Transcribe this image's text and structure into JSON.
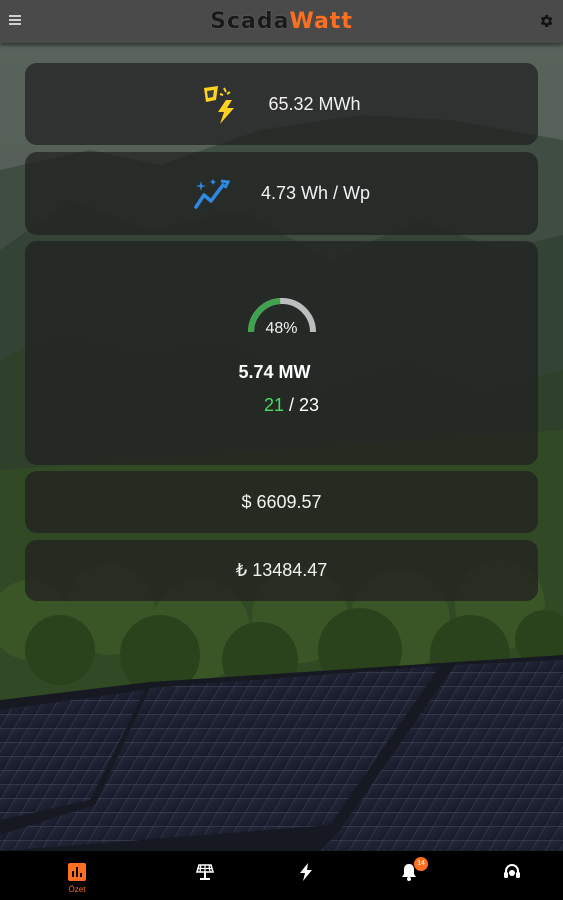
{
  "header": {
    "logo_part1": "Scada",
    "logo_part2": "Watt",
    "menu_icon": "hamburger-icon",
    "settings_icon": "gear-icon"
  },
  "cards": {
    "energy": {
      "icon": "sun-bolt-icon",
      "value": "65.32 MWh"
    },
    "yield": {
      "icon": "trend-sparkle-icon",
      "value": "4.73 Wh / Wp"
    },
    "power": {
      "gauge_percent": "48%",
      "gauge_fraction": 0.48,
      "power": "5.74 MW",
      "active": "21",
      "separator": "/",
      "total": "23"
    },
    "revenue_usd": {
      "value": "$ 6609.57"
    },
    "revenue_try": {
      "value": "₺ 13484.47"
    }
  },
  "bottom_nav": {
    "items": [
      {
        "name": "dashboard",
        "icon": "bar-chart-icon",
        "label": "Özet",
        "active": true
      },
      {
        "name": "plants",
        "icon": "solar-plant-icon",
        "label": ""
      },
      {
        "name": "power",
        "icon": "bolt-icon",
        "label": ""
      },
      {
        "name": "alarms",
        "icon": "bell-icon",
        "label": "",
        "badge": "14"
      },
      {
        "name": "support",
        "icon": "headset-icon",
        "label": ""
      }
    ]
  },
  "colors": {
    "accent": "#ff6f1f",
    "active_green": "#4cd964",
    "gauge_green": "#3fa34d",
    "gauge_gray": "#bdbdbd",
    "icon_blue": "#2e8ae6",
    "icon_yellow": "#ffd21f"
  }
}
